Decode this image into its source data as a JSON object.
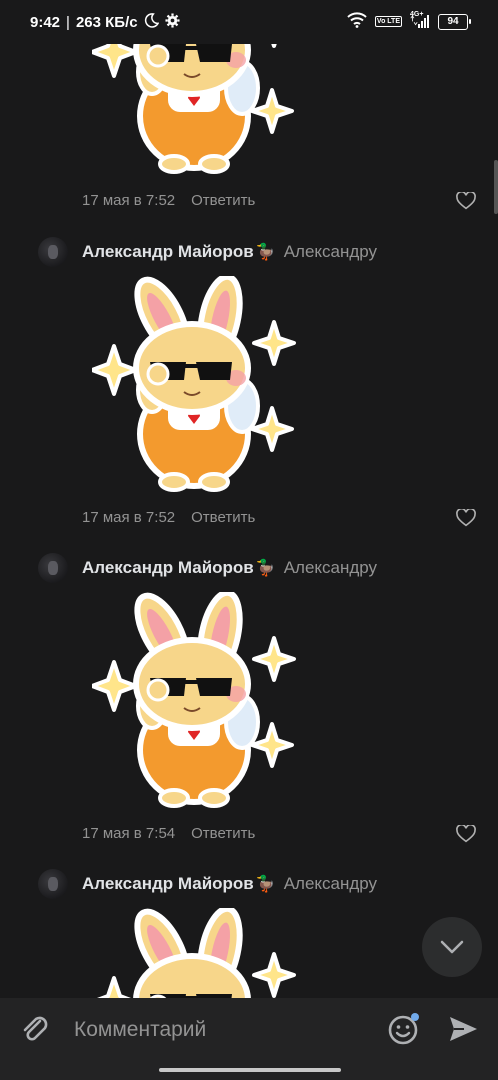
{
  "status_bar": {
    "time": "9:42",
    "separator": "|",
    "speed": "263 КБ/с",
    "network": "4G+",
    "lte": "Vo LTE",
    "battery": "94"
  },
  "comments": [
    {
      "author": "",
      "reply_to": "",
      "timestamp": "17 мая в 7:52",
      "reply_label": "Ответить"
    },
    {
      "author": "Александр Майоров",
      "emoji": "🦆",
      "reply_to": "Александру",
      "timestamp": "17 мая в 7:52",
      "reply_label": "Ответить"
    },
    {
      "author": "Александр Майоров",
      "emoji": "🦆",
      "reply_to": "Александру",
      "timestamp": "17 мая в 7:54",
      "reply_label": "Ответить"
    },
    {
      "author": "Александр Майоров",
      "emoji": "🦆",
      "reply_to": "Александру",
      "timestamp": "",
      "reply_label": ""
    }
  ],
  "composer": {
    "placeholder": "Комментарий"
  },
  "colors": {
    "background": "#19191a",
    "secondary_text": "#939393",
    "primary_text": "#e1e3e6",
    "accent": "#71aaeb"
  },
  "icons": {
    "attach": "paperclip-icon",
    "emoji": "smile-icon",
    "send": "send-icon",
    "like": "heart-icon",
    "scroll": "chevron-down-icon"
  }
}
